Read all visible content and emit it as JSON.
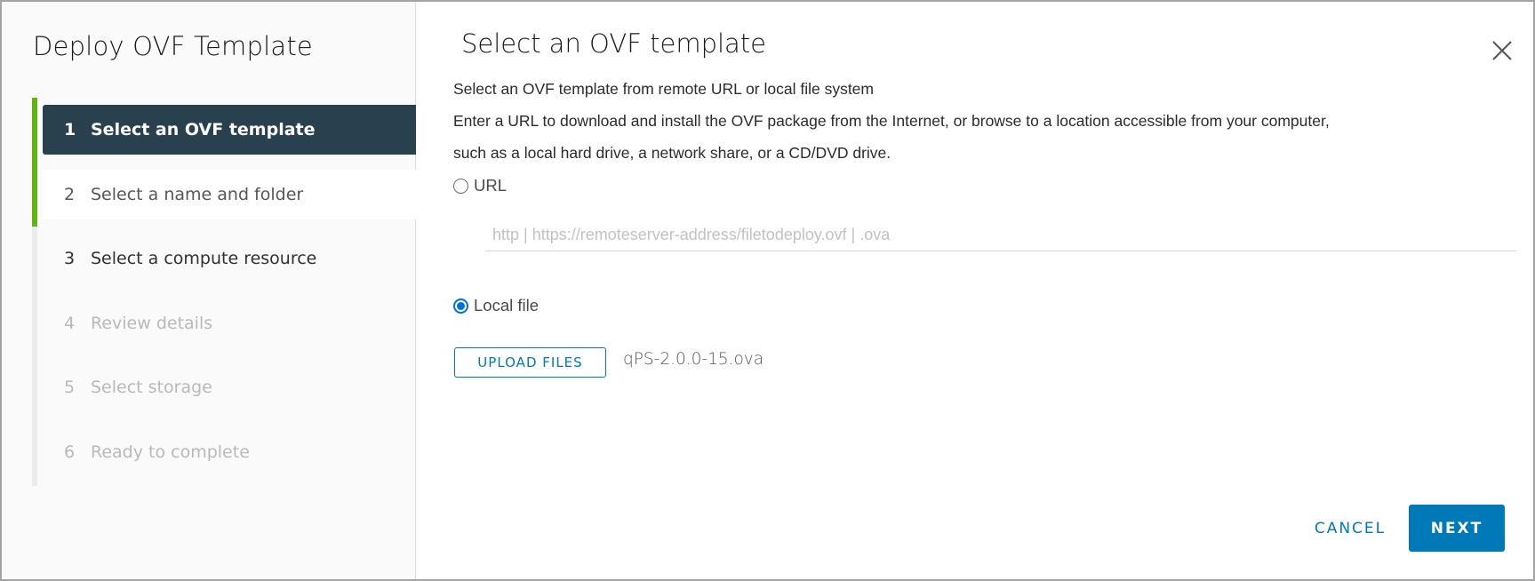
{
  "wizard": {
    "title": "Deploy OVF Template",
    "progress_completed_steps": 2,
    "progress_total_steps": 6,
    "steps": [
      {
        "number": "1",
        "label": "Select an OVF template",
        "state": "active"
      },
      {
        "number": "2",
        "label": "Select a name and folder",
        "state": "enabled"
      },
      {
        "number": "3",
        "label": "Select a compute resource",
        "state": "enabled"
      },
      {
        "number": "4",
        "label": "Review details",
        "state": "disabled"
      },
      {
        "number": "5",
        "label": "Select storage",
        "state": "disabled"
      },
      {
        "number": "6",
        "label": "Ready to complete",
        "state": "disabled"
      }
    ]
  },
  "main": {
    "title": "Select an OVF template",
    "close_icon": "close-x-icon",
    "description_1": "Select an OVF template from remote URL or local file system",
    "description_2": "Enter a URL to download and install the OVF package from the Internet, or browse to a location accessible from your computer,",
    "description_3": "such as a local hard drive, a network share, or a CD/DVD drive.",
    "source_options": {
      "url": {
        "label": "URL",
        "selected": false
      },
      "local_file": {
        "label": "Local file",
        "selected": true
      }
    },
    "url_input": {
      "value": "",
      "placeholder": "http | https://remoteserver-address/filetodeploy.ovf | .ova"
    },
    "upload_button_label": "UPLOAD FILES",
    "selected_file": "qPS-2.0.0-15.ova"
  },
  "footer": {
    "cancel_label": "CANCEL",
    "next_label": "NEXT"
  },
  "colors": {
    "accent": "#0079b8",
    "progress_green": "#62b313",
    "active_step_bg": "#29414e",
    "radio_selected": "#0072d6"
  }
}
